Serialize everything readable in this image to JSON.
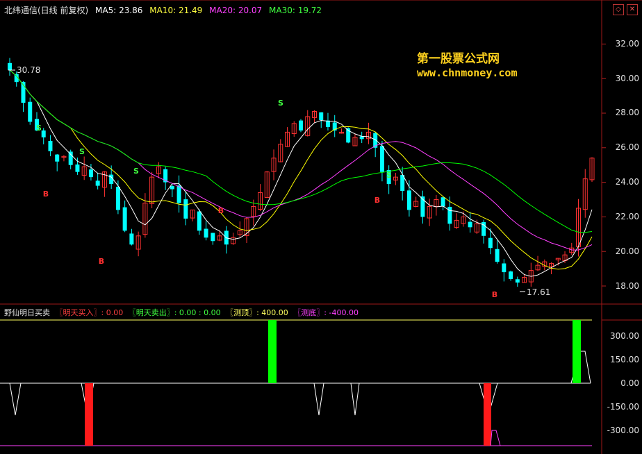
{
  "header": {
    "title": "北纬通信(日线 前复权)",
    "ma5": "MA5: 23.86",
    "ma10": "MA10: 21.49",
    "ma20": "MA20: 20.07",
    "ma30": "MA30: 19.72"
  },
  "watermark": {
    "line1": "第一股票公式网",
    "line2": "www.chnmoney.com"
  },
  "price_axis": {
    "ticks": [
      "32.00",
      "30.00",
      "28.00",
      "26.00",
      "24.00",
      "22.00",
      "20.00",
      "18.00"
    ]
  },
  "annotations": {
    "high": "30.78",
    "low": "17.61"
  },
  "indicator": {
    "name": "野仙明日买卖",
    "buy": "〖明天买入〗: 0.00",
    "sell": "〖明天卖出〗: 0.00 : 0.00",
    "top": "〖测顶〗: 400.00",
    "bottom": "〖测底〗: -400.00",
    "ticks": [
      "300.00",
      "150.00",
      "0.00",
      "-150.00",
      "-300.00"
    ]
  },
  "signals": {
    "buy_label": "B",
    "sell_label": "S"
  },
  "colors": {
    "up": "#ff3232",
    "down": "#00ffff",
    "ma5": "#ffffff",
    "ma10": "#ffff00",
    "ma20": "#ff40ff",
    "ma30": "#00ff00",
    "axis": "#b02020"
  }
}
